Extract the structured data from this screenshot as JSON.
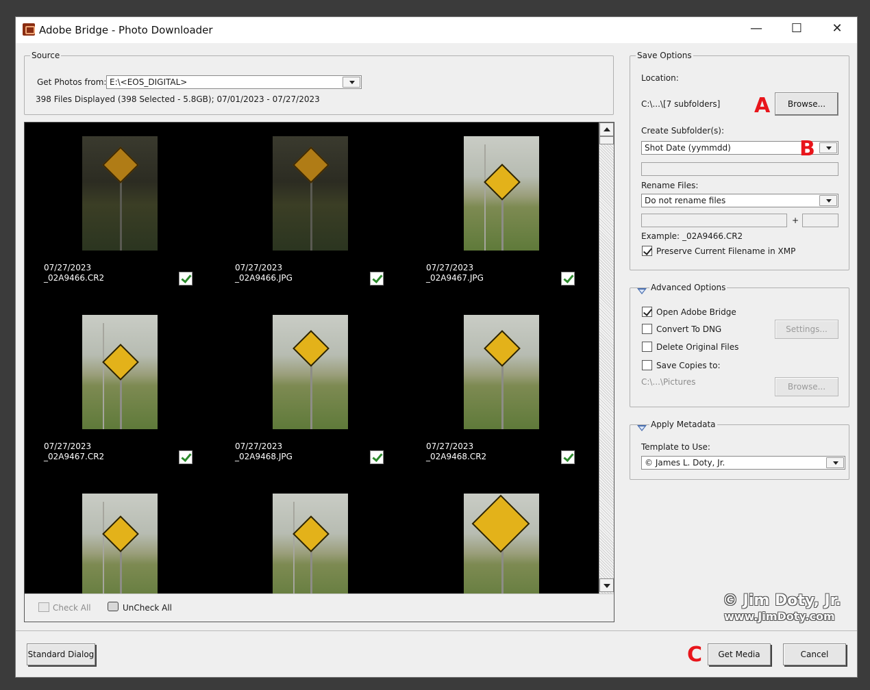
{
  "window": {
    "title": "Adobe Bridge - Photo Downloader",
    "controls": {
      "minimize": "—",
      "maximize": "☐",
      "close": "✕"
    }
  },
  "source": {
    "group_label": "Source",
    "get_photos_label": "Get Photos from:",
    "get_photos_value": "E:\\<EOS_DIGITAL>",
    "files_summary": "398 Files Displayed (398 Selected - 5.8GB); 07/01/2023 - 07/27/2023"
  },
  "thumbnails": [
    {
      "date": "07/27/2023",
      "filename": "_02A9466.CR2",
      "checked": true
    },
    {
      "date": "07/27/2023",
      "filename": "_02A9466.JPG",
      "checked": true
    },
    {
      "date": "07/27/2023",
      "filename": "_02A9467.JPG",
      "checked": true
    },
    {
      "date": "07/27/2023",
      "filename": "_02A9467.CR2",
      "checked": true
    },
    {
      "date": "07/27/2023",
      "filename": "_02A9468.JPG",
      "checked": true
    },
    {
      "date": "07/27/2023",
      "filename": "_02A9468.CR2",
      "checked": true
    }
  ],
  "grid_toolbar": {
    "check_all": "Check All",
    "uncheck_all": "UnCheck All"
  },
  "save_options": {
    "group_label": "Save Options",
    "location_label": "Location:",
    "location_value": "C:\\...\\[7 subfolders]",
    "browse_label": "Browse...",
    "create_subfolders_label": "Create Subfolder(s):",
    "create_subfolders_value": "Shot Date (yymmdd)",
    "rename_files_label": "Rename Files:",
    "rename_files_value": "Do not rename files",
    "plus": "+",
    "example_label": "Example:",
    "example_value": "_02A9466.CR2",
    "preserve_label": "Preserve Current Filename in XMP",
    "preserve_checked": true
  },
  "advanced_options": {
    "group_label": "Advanced Options",
    "open_bridge_label": "Open Adobe Bridge",
    "open_bridge_checked": true,
    "convert_dng_label": "Convert To DNG",
    "convert_dng_checked": false,
    "settings_label": "Settings...",
    "delete_originals_label": "Delete Original Files",
    "delete_originals_checked": false,
    "save_copies_label": "Save Copies to:",
    "save_copies_checked": false,
    "save_copies_path": "C:\\...\\Pictures",
    "browse_label": "Browse..."
  },
  "apply_metadata": {
    "group_label": "Apply Metadata",
    "template_label": "Template to Use:",
    "template_value": "© James L. Doty, Jr."
  },
  "footer": {
    "standard_dialog": "Standard Dialog",
    "get_media": "Get Media",
    "cancel": "Cancel"
  },
  "annotations": {
    "a": "A",
    "b": "B",
    "c": "C"
  },
  "watermark": {
    "line1": "© Jim Doty, Jr.",
    "line2": "www.JimDoty.com"
  },
  "colors": {
    "annotation_red": "#e8151b",
    "dialog_bg": "#efefef",
    "grid_bg": "#000000",
    "checkmark_green": "#2b8a2b"
  },
  "icons": [
    "app-icon",
    "dropdown-arrow-icon",
    "scroll-up-icon",
    "scroll-down-icon",
    "check-all-icon",
    "uncheck-all-icon",
    "collapse-triangle-icon"
  ]
}
